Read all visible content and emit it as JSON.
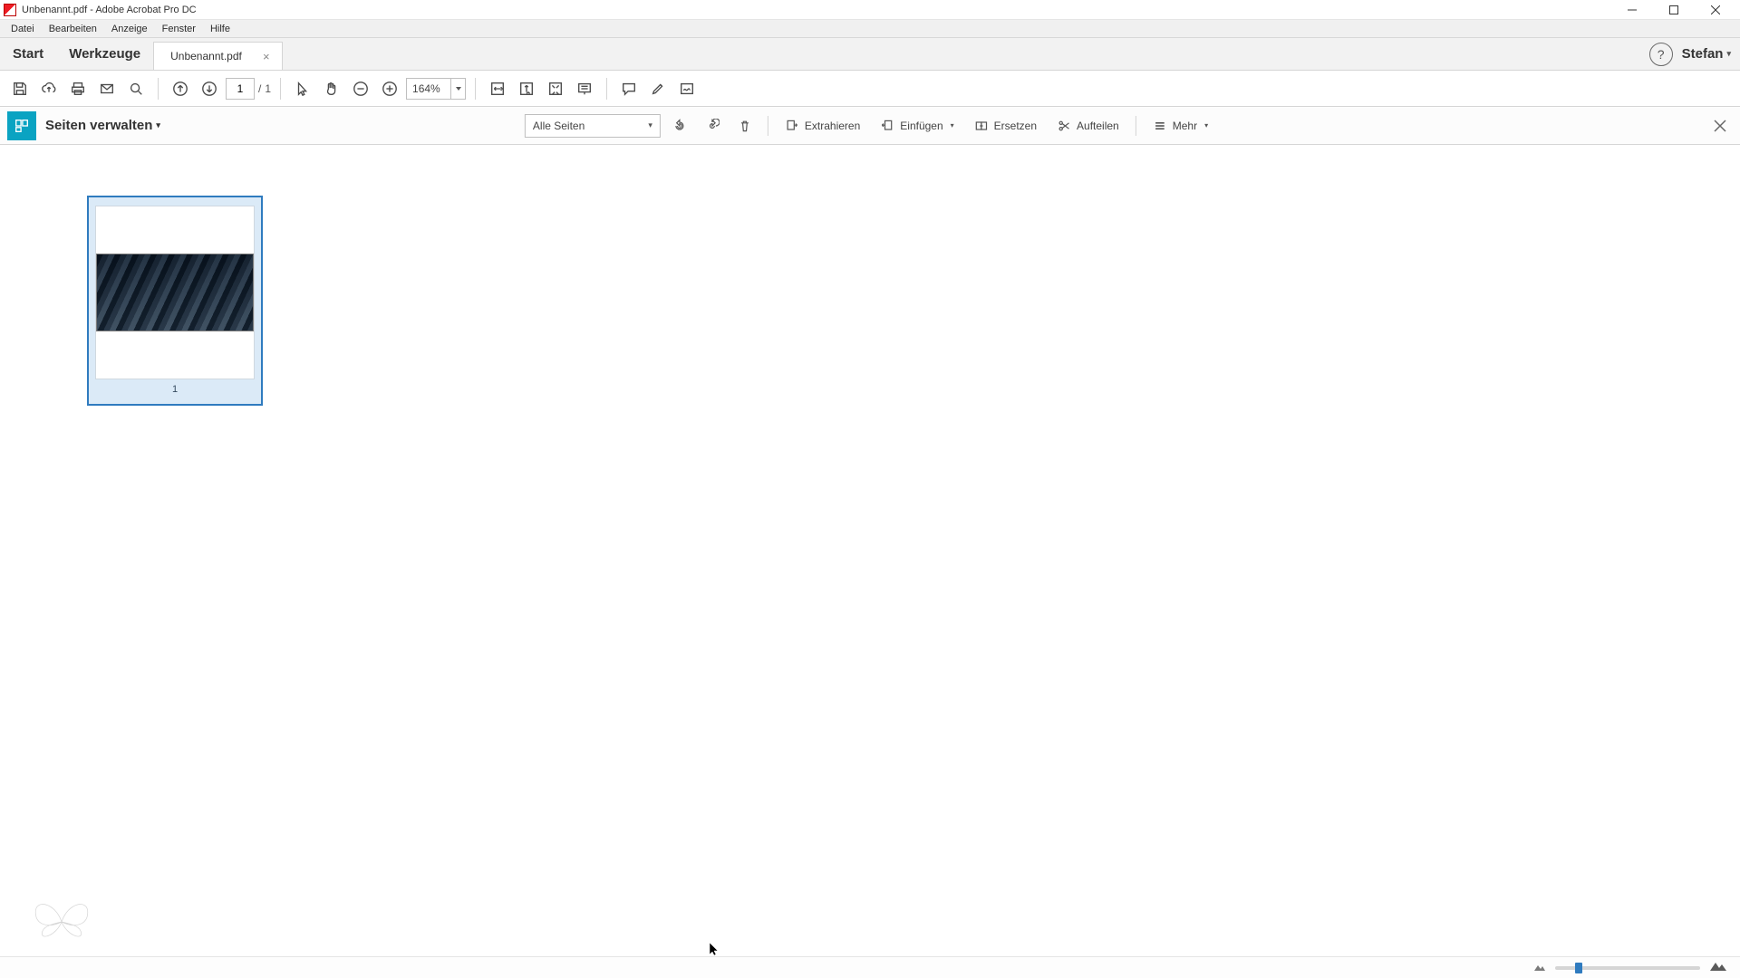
{
  "window": {
    "title": "Unbenannt.pdf - Adobe Acrobat Pro DC"
  },
  "menubar": {
    "items": [
      "Datei",
      "Bearbeiten",
      "Anzeige",
      "Fenster",
      "Hilfe"
    ]
  },
  "tabs": {
    "home": "Start",
    "tools": "Werkzeuge",
    "doc_label": "Unbenannt.pdf",
    "user": "Stefan"
  },
  "toolbar": {
    "page_current": "1",
    "page_total": "1",
    "zoom": "164%"
  },
  "subbar": {
    "title": "Seiten verwalten",
    "filter": "Alle Seiten",
    "extract": "Extrahieren",
    "insert": "Einfügen",
    "replace": "Ersetzen",
    "split": "Aufteilen",
    "more": "Mehr"
  },
  "thumb": {
    "page_number": "1"
  }
}
